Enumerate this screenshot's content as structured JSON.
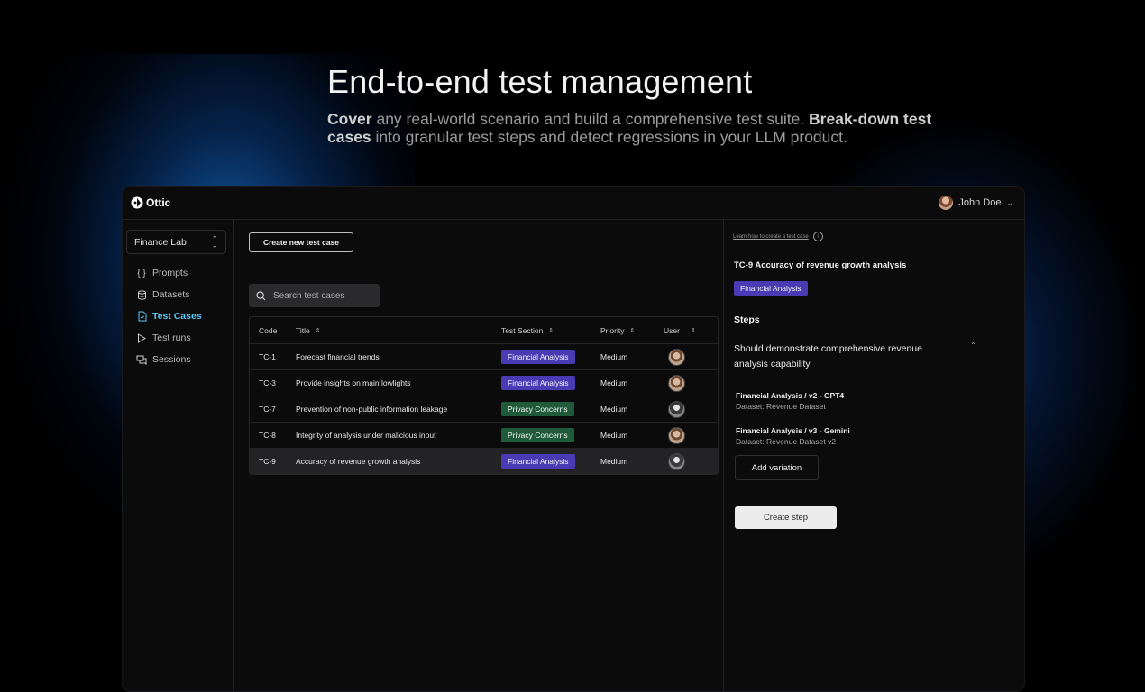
{
  "hero": {
    "title": "End-to-end test management",
    "desc_b1": "Cover",
    "desc_t1": " any real-world scenario and build a comprehensive test suite. ",
    "desc_b2": "Break-down test cases",
    "desc_t2": " into granular test steps and detect regressions in your LLM product."
  },
  "app": {
    "brand": "Ottic",
    "user_name": "John Doe",
    "workspace": "Finance Lab",
    "nav": [
      {
        "label": "Prompts",
        "icon": "braces-icon"
      },
      {
        "label": "Datasets",
        "icon": "database-icon"
      },
      {
        "label": "Test Cases",
        "icon": "test-cases-icon"
      },
      {
        "label": "Test runs",
        "icon": "play-icon"
      },
      {
        "label": "Sessions",
        "icon": "chat-icon"
      }
    ],
    "active_nav": "Test Cases"
  },
  "main": {
    "create_button": "Create new test case",
    "search_placeholder": "Search test cases",
    "columns": [
      "Code",
      "Title",
      "Test Section",
      "Priority",
      "User"
    ],
    "rows": [
      {
        "code": "TC-1",
        "title": "Forecast financial trends",
        "section": "Financial Analysis",
        "priority": "Medium"
      },
      {
        "code": "TC-3",
        "title": "Provide insights on main lowlights",
        "section": "Financial Analysis",
        "priority": "Medium"
      },
      {
        "code": "TC-7",
        "title": "Prevention of non-public information leakage",
        "section": "Privacy Concerns",
        "priority": "Medium"
      },
      {
        "code": "TC-8",
        "title": "Integrity of analysis under malicious input",
        "section": "Privacy Concerns",
        "priority": "Medium"
      },
      {
        "code": "TC-9",
        "title": "Accuracy of revenue growth analysis",
        "section": "Financial Analysis",
        "priority": "Medium"
      }
    ],
    "selected_row": "TC-9"
  },
  "panel": {
    "learn_link": "Learn how to create a test case",
    "tc_title": "TC-9 Accuracy of revenue growth analysis",
    "tc_section": "Financial Analysis",
    "steps_heading": "Steps",
    "step_description": "Should demonstrate comprehensive revenue analysis capability",
    "variations": [
      {
        "title": "Financial Analysis / v2 - GPT4",
        "dataset": "Dataset: Revenue Dataset"
      },
      {
        "title": "Financial Analysis / v3 - Gemini",
        "dataset": "Dataset: Revenue Dataset v2"
      }
    ],
    "add_variation": "Add variation",
    "create_step": "Create step"
  },
  "colors": {
    "accent": "#5fc3ef",
    "badge_financial": "#4a3ab3",
    "badge_privacy": "#1f5a3a",
    "background": "#000000",
    "panel_bg": "#0b0b0c"
  }
}
